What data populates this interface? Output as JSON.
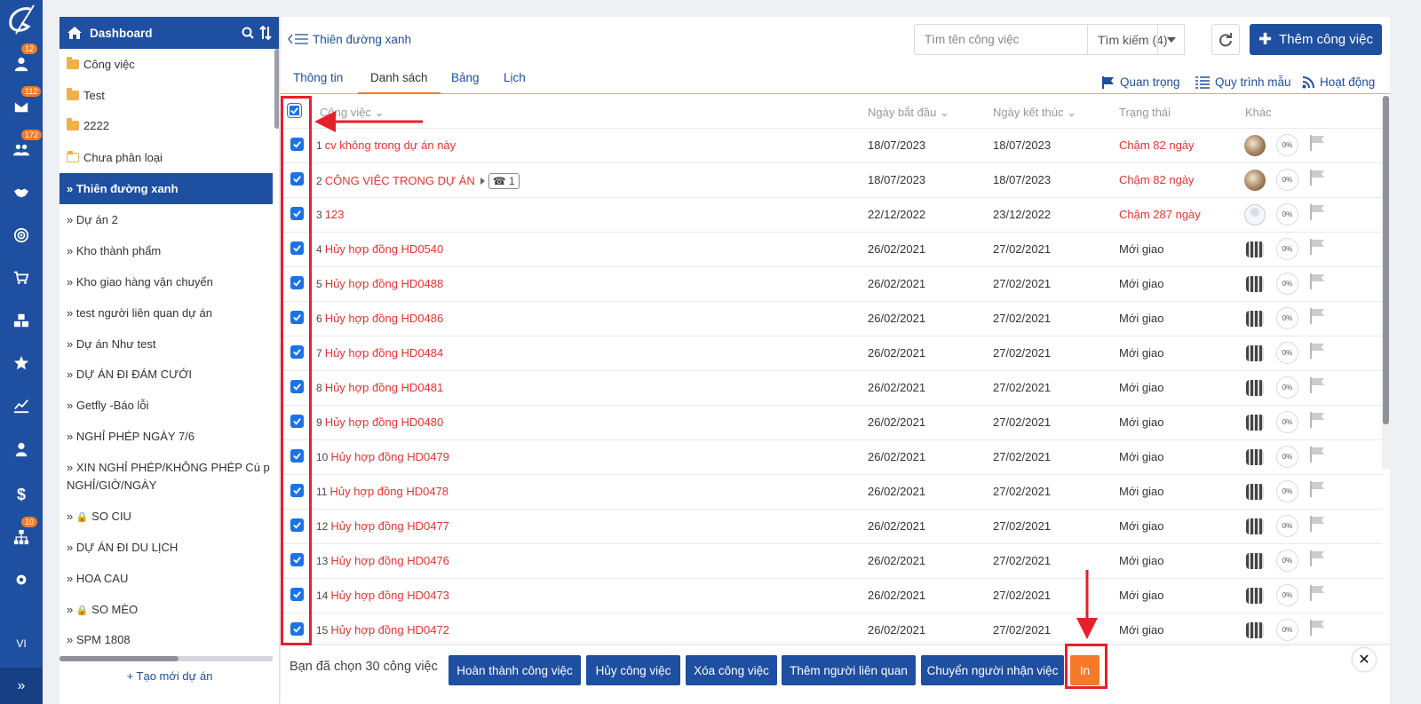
{
  "rail": {
    "badges": {
      "user": "12",
      "inbox": "112",
      "group": "172",
      "org": "10"
    },
    "lang": "VI"
  },
  "sidebar": {
    "title": "Dashboard",
    "items": [
      {
        "label": "Công việc",
        "type": "folder"
      },
      {
        "label": "Test",
        "type": "folder"
      },
      {
        "label": "2222",
        "type": "folder"
      },
      {
        "label": "Chưa phân loại",
        "type": "folder-open"
      },
      {
        "label": "» Thiên đường xanh",
        "type": "active"
      },
      {
        "label": "» Dự án 2"
      },
      {
        "label": "» Kho thành phẩm"
      },
      {
        "label": "» Kho giao hàng vận chuyển"
      },
      {
        "label": "» test người liên quan dự án"
      },
      {
        "label": "» Dự án Như test"
      },
      {
        "label": "» DỰ ÁN ĐI ĐÁM CƯỚI"
      },
      {
        "label": "» Getfly -Báo lỗi"
      },
      {
        "label": "» NGHỈ PHÉP NGÀY 7/6"
      },
      {
        "label": "» XIN NGHỈ PHÉP/KHÔNG PHÉP Cú p NGHỈ/GIỜ/NGÀY"
      },
      {
        "label": "» SO CIU",
        "locked": true
      },
      {
        "label": "» DỰ ÁN ĐI DU LỊCH"
      },
      {
        "label": "» HOA CAU"
      },
      {
        "label": "» SO MÈO",
        "locked": true
      },
      {
        "label": "» SPM 1808"
      }
    ],
    "new_project": "+ Tạo mới dự án"
  },
  "header": {
    "breadcrumb": "Thiên đường xanh",
    "search_placeholder": "Tìm tên công việc",
    "search_button": "Tìm kiếm (4)",
    "add_button": "Thêm công việc"
  },
  "tabs": [
    "Thông tin",
    "Danh sách",
    "Bảng",
    "Lịch"
  ],
  "right_links": [
    "Quan trọng",
    "Quy trình mẫu",
    "Hoạt động"
  ],
  "table": {
    "columns": [
      "Công việc",
      "Ngày bắt đầu",
      "Ngày kết thúc",
      "Trạng thái",
      "Khác"
    ],
    "rows": [
      {
        "num": "1",
        "name": "cv không trong dự án này",
        "start": "18/07/2023",
        "end": "18/07/2023",
        "status": "Chậm 82 ngày",
        "late": true,
        "avatar": "photo",
        "pct": "0%"
      },
      {
        "num": "2",
        "name": "CÔNG VIỆC TRONG DỰ ÁN",
        "start": "18/07/2023",
        "end": "18/07/2023",
        "status": "Chậm 82 ngày",
        "late": true,
        "avatar": "photo",
        "pct": "0%",
        "subtasks": "1"
      },
      {
        "num": "3",
        "name": "123",
        "start": "22/12/2022",
        "end": "23/12/2022",
        "status": "Chậm 287 ngày",
        "late": true,
        "avatar": "blank",
        "pct": "0%"
      },
      {
        "num": "4",
        "name": "Hủy hợp đồng HD0540",
        "start": "26/02/2021",
        "end": "27/02/2021",
        "status": "Mới giao",
        "avatar": "multi",
        "pct": "0%"
      },
      {
        "num": "5",
        "name": "Hủy hợp đồng HD0488",
        "start": "26/02/2021",
        "end": "27/02/2021",
        "status": "Mới giao",
        "avatar": "multi",
        "pct": "0%"
      },
      {
        "num": "6",
        "name": "Hủy hợp đồng HD0486",
        "start": "26/02/2021",
        "end": "27/02/2021",
        "status": "Mới giao",
        "avatar": "multi",
        "pct": "0%"
      },
      {
        "num": "7",
        "name": "Hủy hợp đồng HD0484",
        "start": "26/02/2021",
        "end": "27/02/2021",
        "status": "Mới giao",
        "avatar": "multi",
        "pct": "0%"
      },
      {
        "num": "8",
        "name": "Hủy hợp đồng HD0481",
        "start": "26/02/2021",
        "end": "27/02/2021",
        "status": "Mới giao",
        "avatar": "multi",
        "pct": "0%"
      },
      {
        "num": "9",
        "name": "Hủy hợp đồng HD0480",
        "start": "26/02/2021",
        "end": "27/02/2021",
        "status": "Mới giao",
        "avatar": "multi",
        "pct": "0%"
      },
      {
        "num": "10",
        "name": "Hủy hợp đồng HD0479",
        "start": "26/02/2021",
        "end": "27/02/2021",
        "status": "Mới giao",
        "avatar": "multi",
        "pct": "0%"
      },
      {
        "num": "11",
        "name": "Hủy hợp đồng HD0478",
        "start": "26/02/2021",
        "end": "27/02/2021",
        "status": "Mới giao",
        "avatar": "multi",
        "pct": "0%"
      },
      {
        "num": "12",
        "name": "Hủy hợp đồng HD0477",
        "start": "26/02/2021",
        "end": "27/02/2021",
        "status": "Mới giao",
        "avatar": "multi",
        "pct": "0%"
      },
      {
        "num": "13",
        "name": "Hủy hợp đồng HD0476",
        "start": "26/02/2021",
        "end": "27/02/2021",
        "status": "Mới giao",
        "avatar": "multi",
        "pct": "0%"
      },
      {
        "num": "14",
        "name": "Hủy hợp đồng HD0473",
        "start": "26/02/2021",
        "end": "27/02/2021",
        "status": "Mới giao",
        "avatar": "multi",
        "pct": "0%"
      },
      {
        "num": "15",
        "name": "Hủy hợp đồng HD0472",
        "start": "26/02/2021",
        "end": "27/02/2021",
        "status": "Mới giao",
        "avatar": "multi",
        "pct": "0%"
      }
    ]
  },
  "actionbar": {
    "selected_text": "Bạn đã chọn 30 công việc",
    "buttons": [
      "Hoàn thành công việc",
      "Hủy công việc",
      "Xóa công việc",
      "Thêm người liên quan",
      "Chuyển người nhận việc",
      "In"
    ]
  },
  "colors": {
    "primary": "#1e4fa0",
    "accent": "#f47a2a",
    "late": "#e5342e",
    "annotation": "#e5202a"
  }
}
